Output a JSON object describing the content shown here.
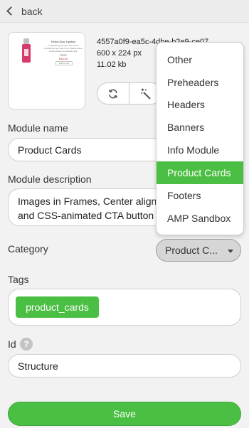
{
  "header": {
    "back_label": "back"
  },
  "thumbnail": {
    "title": "Extra Glow Lipstick",
    "description": "Long-lasting formula. The colors complement any skin tone. Natural shine, moisturization for delicate lips.",
    "price_old": "$24.00",
    "price": "$18.00",
    "cta": "Add to cart"
  },
  "file_info": {
    "name": "4557a0f9-ea5c-4dbe-b2e9-ce07",
    "dimensions": "600 x 224 px",
    "size": "11.02 kb"
  },
  "form": {
    "module_name_label": "Module name",
    "module_name_value": "Product Cards",
    "module_description_label": "Module description",
    "module_description_value": [
      "Images in Frames, Center align",
      "and CSS-animated CTA button"
    ],
    "category_label": "Category",
    "category_value": "Product C...",
    "tags_label": "Tags",
    "tags": [
      "product_cards"
    ],
    "id_label": "Id",
    "id_value": "Structure",
    "save_label": "Save"
  },
  "dropdown": {
    "options": [
      "Other",
      "Preheaders",
      "Headers",
      "Banners",
      "Info Module",
      "Product Cards",
      "Footers",
      "AMP Sandbox"
    ],
    "selected": "Product Cards"
  },
  "colors": {
    "accent": "#4bbf43",
    "background": "#f2f2f2"
  }
}
